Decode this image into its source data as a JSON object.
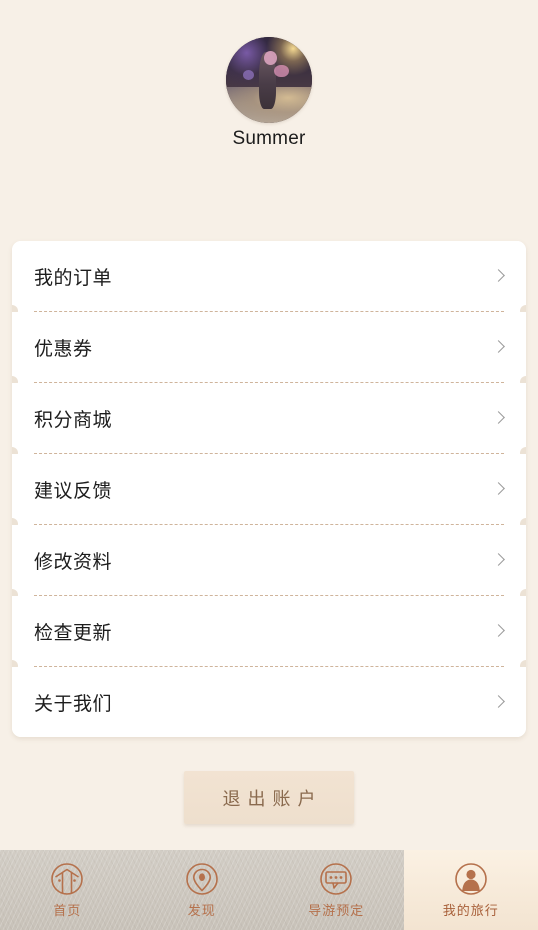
{
  "theme": {
    "page_bg": "#f7f0e7",
    "card_bg": "#ffffff",
    "accent_brown": "#b5714c",
    "perforation": "#cfb49b",
    "tabbar_bg": "#c8c2b9",
    "active_tab_bg": "#f7ead9",
    "logout_bg": "#eee0ce",
    "logout_text": "#8a6a4e"
  },
  "profile": {
    "avatar_icon": "user-photo-avatar",
    "username": "Summer"
  },
  "menu": {
    "items": [
      {
        "label": "我的订单",
        "icon": "chevron-right-icon"
      },
      {
        "label": "优惠券",
        "icon": "chevron-right-icon"
      },
      {
        "label": "积分商城",
        "icon": "chevron-right-icon"
      },
      {
        "label": "建议反馈",
        "icon": "chevron-right-icon"
      },
      {
        "label": "修改资料",
        "icon": "chevron-right-icon"
      },
      {
        "label": "检查更新",
        "icon": "chevron-right-icon"
      },
      {
        "label": "关于我们",
        "icon": "chevron-right-icon"
      }
    ]
  },
  "logout": {
    "label": "退出账户"
  },
  "tabbar": {
    "items": [
      {
        "label": "首页",
        "icon": "home-gate-icon",
        "active": false
      },
      {
        "label": "发现",
        "icon": "location-pin-icon",
        "active": false
      },
      {
        "label": "导游预定",
        "icon": "chat-bubble-icon",
        "active": false
      },
      {
        "label": "我的旅行",
        "icon": "user-profile-icon",
        "active": true
      }
    ]
  }
}
